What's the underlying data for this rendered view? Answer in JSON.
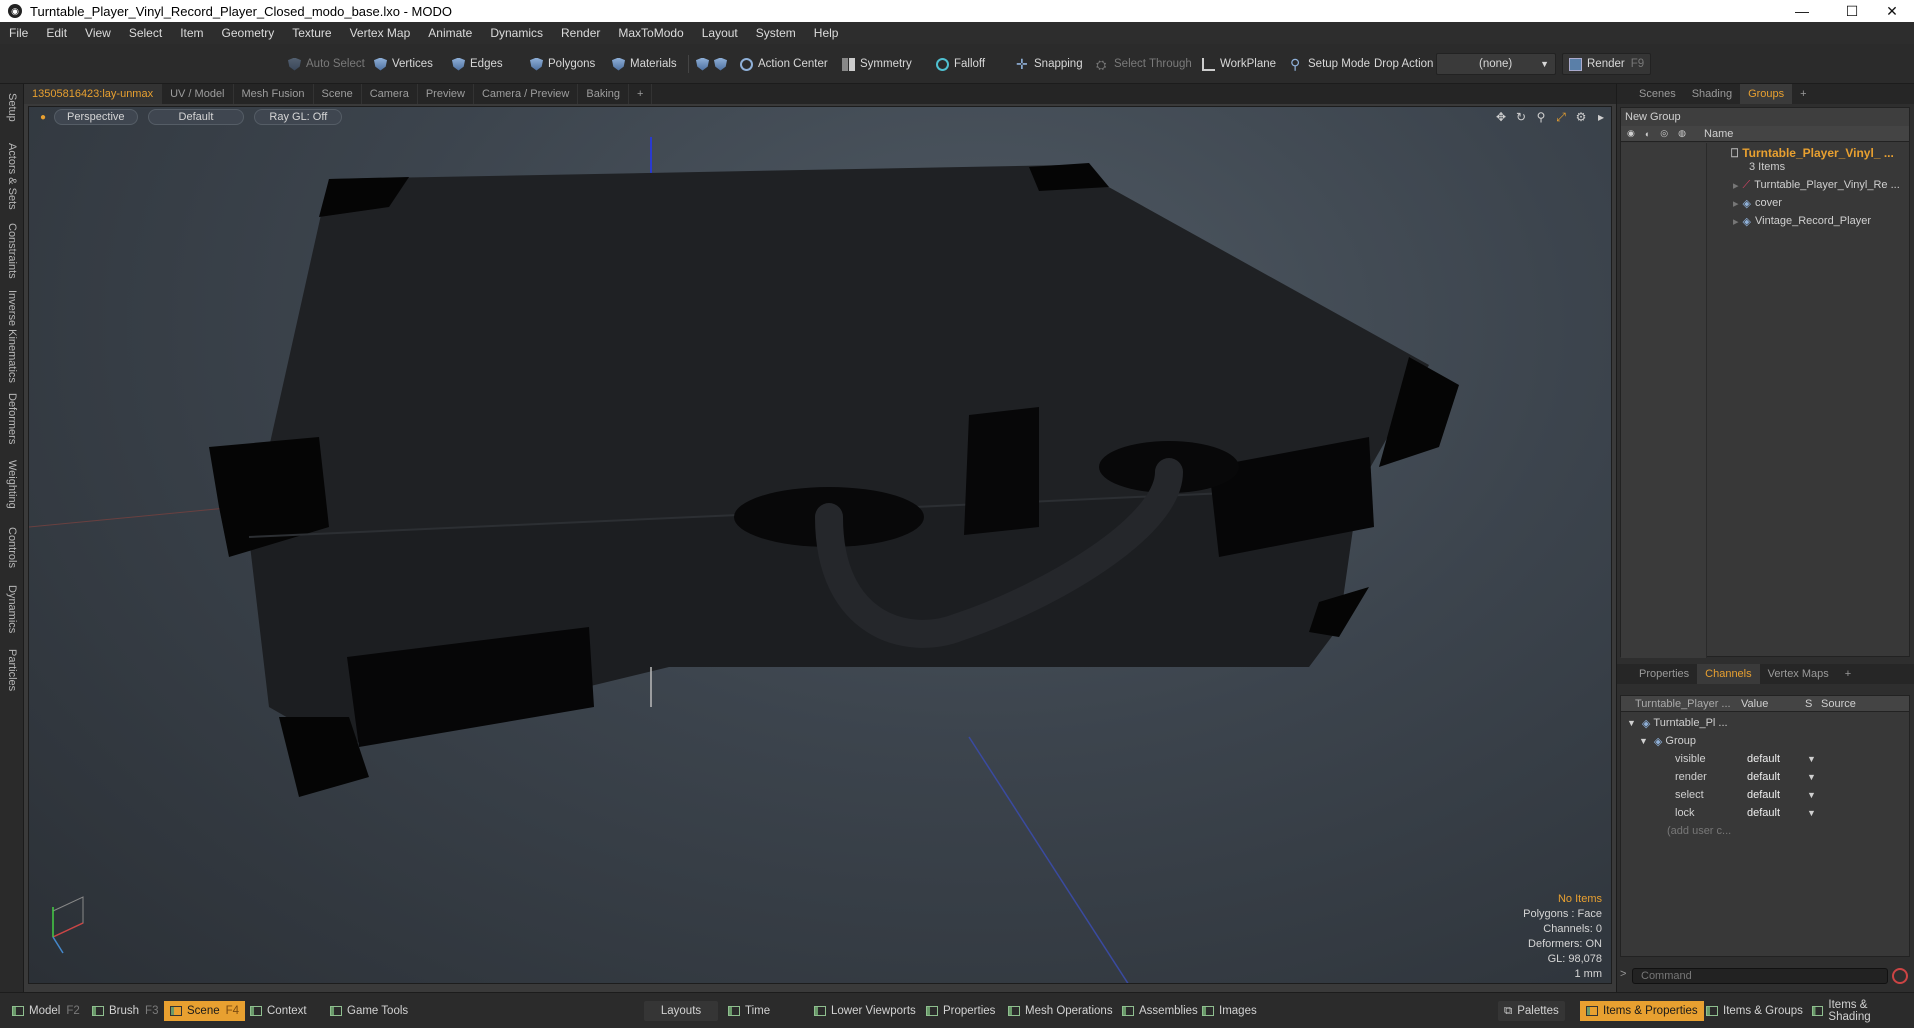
{
  "window": {
    "title": "Turntable_Player_Vinyl_Record_Player_Closed_modo_base.lxo - MODO",
    "minimize": "—",
    "maximize": "☐",
    "close": "✕"
  },
  "menu": [
    "File",
    "Edit",
    "View",
    "Select",
    "Item",
    "Geometry",
    "Texture",
    "Vertex Map",
    "Animate",
    "Dynamics",
    "Render",
    "MaxToModo",
    "Layout",
    "System",
    "Help"
  ],
  "toolbar": {
    "auto_select": "Auto Select",
    "vertices": "Vertices",
    "edges": "Edges",
    "polygons": "Polygons",
    "materials": "Materials",
    "action_center": "Action Center",
    "symmetry": "Symmetry",
    "falloff": "Falloff",
    "snapping": "Snapping",
    "select_through": "Select Through",
    "workplane": "WorkPlane",
    "setup_mode": "Setup Mode",
    "drop_action": "Drop Action",
    "drop_value": "(none)",
    "render": "Render",
    "render_key": "F9"
  },
  "left_tabs": [
    "Setup",
    "Actors & Sets",
    "Constraints",
    "Inverse Kinematics",
    "Deformers",
    "Weighting",
    "Controls",
    "Dynamics",
    "Particles"
  ],
  "viewport_tabs": [
    "13505816423:lay-unmax",
    "UV / Model",
    "Mesh Fusion",
    "Scene",
    "Camera",
    "Preview",
    "Camera / Preview",
    "Baking",
    "+"
  ],
  "viewport": {
    "view": "Perspective",
    "shading": "Default",
    "raygl": "Ray GL: Off"
  },
  "stats": {
    "items": "No Items",
    "polygons": "Polygons : Face",
    "channels": "Channels: 0",
    "deformers": "Deformers: ON",
    "gl": "GL: 98,078",
    "scale": "1 mm"
  },
  "right_tabs": [
    "Scenes",
    "Shading",
    "Groups",
    "+"
  ],
  "groups": {
    "new_group": "New Group",
    "col_name": "Name",
    "root": "Turntable_Player_Vinyl_ ...",
    "count": "3 Items",
    "children": [
      "Turntable_Player_Vinyl_Re ...",
      "cover",
      "Vintage_Record_Player"
    ]
  },
  "lower_tabs": [
    "Properties",
    "Channels",
    "Vertex Maps",
    "+"
  ],
  "channels": {
    "col_item": "Turntable_Player ...",
    "col_value": "Value",
    "col_s": "S",
    "col_source": "Source",
    "root": "Turntable_Pl ...",
    "group": "Group",
    "rows": [
      {
        "name": "visible",
        "value": "default"
      },
      {
        "name": "render",
        "value": "default"
      },
      {
        "name": "select",
        "value": "default"
      },
      {
        "name": "lock",
        "value": "default"
      }
    ],
    "add": "(add user c..."
  },
  "command_placeholder": "Command",
  "statusbar": {
    "model": "Model",
    "model_key": "F2",
    "brush": "Brush",
    "brush_key": "F3",
    "scene": "Scene",
    "scene_key": "F4",
    "context": "Context",
    "game_tools": "Game Tools",
    "layouts": "Layouts",
    "time": "Time",
    "lower_viewports": "Lower Viewports",
    "properties": "Properties",
    "mesh_operations": "Mesh Operations",
    "assemblies": "Assemblies",
    "images": "Images",
    "palettes": "Palettes",
    "items_properties": "Items & Properties",
    "items_groups": "Items & Groups",
    "items_shading": "Items & Shading"
  },
  "colors": {
    "accent": "#e8a030",
    "viewport_bg": "#3c444d",
    "panel": "#383838"
  }
}
